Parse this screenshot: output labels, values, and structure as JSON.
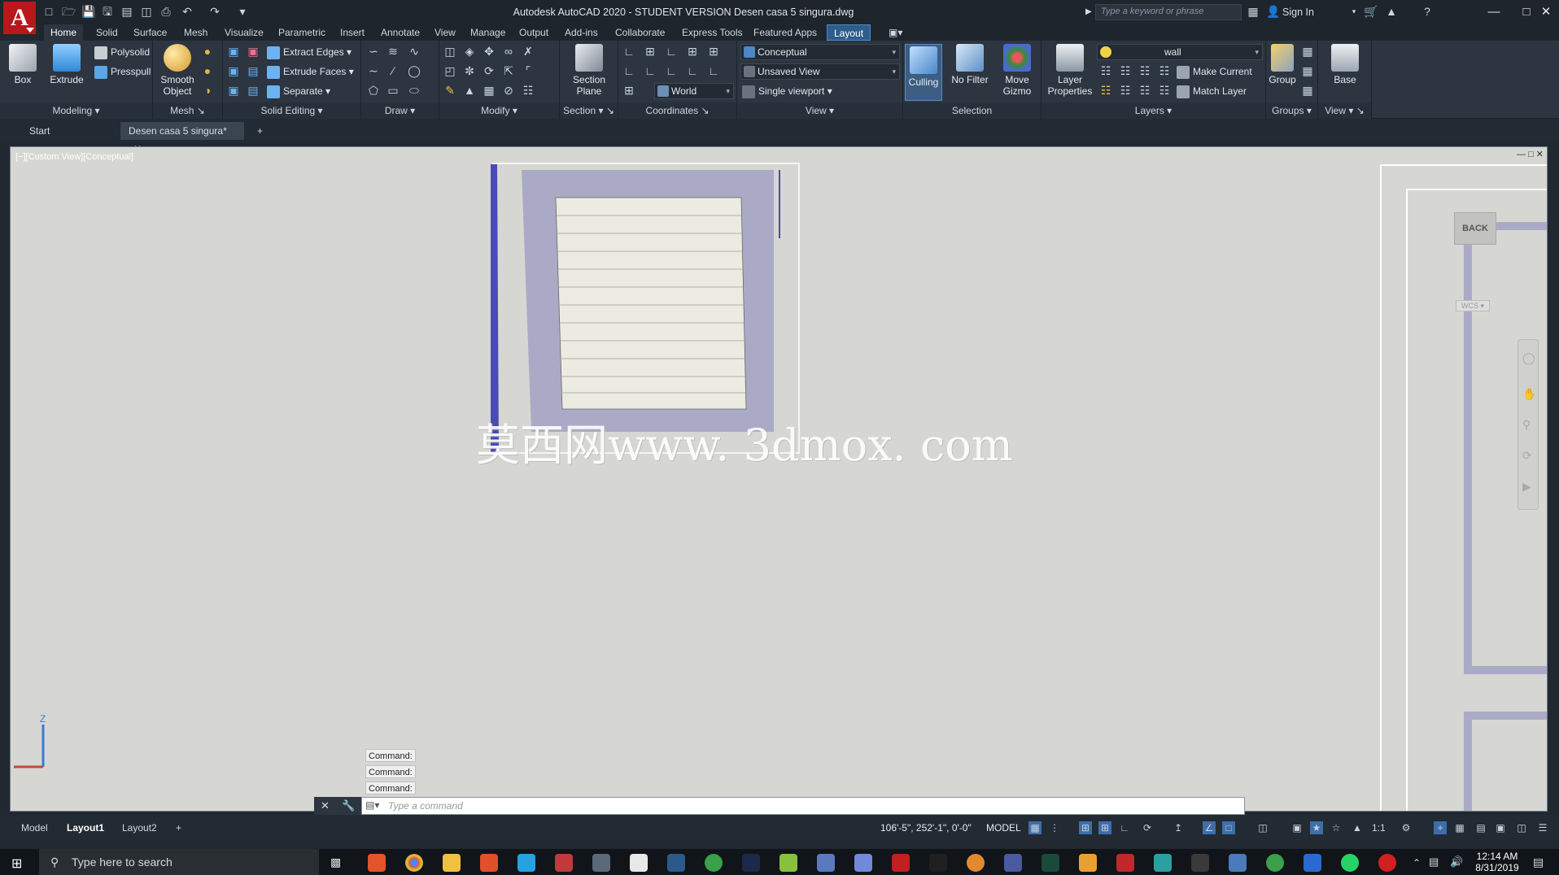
{
  "app": {
    "title": "Autodesk AutoCAD 2020 - STUDENT VERSION    Desen casa 5 singura.dwg",
    "search_placeholder": "Type a keyword or phrase",
    "sign_in": "Sign In"
  },
  "menu_tabs": [
    "Home",
    "Solid",
    "Surface",
    "Mesh",
    "Visualize",
    "Parametric",
    "Insert",
    "Annotate",
    "View",
    "Manage",
    "Output",
    "Add-ins",
    "Collaborate",
    "Express Tools",
    "Featured Apps",
    "Layout"
  ],
  "ribbon": {
    "modeling": {
      "title": "Modeling",
      "box": "Box",
      "extrude": "Extrude",
      "polysolid": "Polysolid",
      "presspull": "Presspull"
    },
    "mesh": {
      "title": "Mesh",
      "smooth_object_1": "Smooth",
      "smooth_object_2": "Object"
    },
    "solid_editing": {
      "title": "Solid Editing",
      "extract_edges": "Extract Edges",
      "extrude_faces": "Extrude Faces",
      "separate": "Separate"
    },
    "draw": {
      "title": "Draw"
    },
    "modify": {
      "title": "Modify"
    },
    "section": {
      "title": "Section",
      "section_plane_1": "Section",
      "section_plane_2": "Plane"
    },
    "coordinates": {
      "title": "Coordinates",
      "world": "World"
    },
    "view": {
      "title": "View",
      "visual_style": "Conceptual",
      "named_view": "Unsaved View",
      "viewport_config": "Single viewport"
    },
    "selection": {
      "title": "Selection",
      "culling": "Culling",
      "no_filter": "No Filter",
      "move_gizmo_1": "Move",
      "move_gizmo_2": "Gizmo"
    },
    "layers": {
      "title": "Layers",
      "layer_properties_1": "Layer",
      "layer_properties_2": "Properties",
      "current_layer": "wall",
      "make_current": "Make Current",
      "match_layer": "Match Layer"
    },
    "groups": {
      "title": "Groups",
      "group": "Group"
    },
    "view2": {
      "title": "View",
      "base": "Base"
    }
  },
  "file_tabs": {
    "start": "Start",
    "drawing": "Desen casa 5 singura*",
    "add": "+"
  },
  "viewport": {
    "label": "[−][Custom View][Conceptual]",
    "viewcube_face": "BACK",
    "wcs": "WCS",
    "watermark": "莫西网www. 3dmox. com",
    "axis_z": "Z"
  },
  "command": {
    "history": [
      "Command:",
      "Command:",
      "Command:"
    ],
    "placeholder": "Type a command"
  },
  "status": {
    "layout_tabs": [
      "Model",
      "Layout1",
      "Layout2"
    ],
    "coordinates": "106'-5\", 252'-1\", 0'-0\"",
    "space": "MODEL",
    "scale": "1:1"
  },
  "taskbar": {
    "search": "Type here to search",
    "time": "12:14 AM",
    "date": "8/31/2019"
  },
  "colors": {
    "accent": "#2f5d8c",
    "wall": "#abaac6",
    "slab": "#ecebe1",
    "viewport_bg": "#d6d6d3"
  }
}
